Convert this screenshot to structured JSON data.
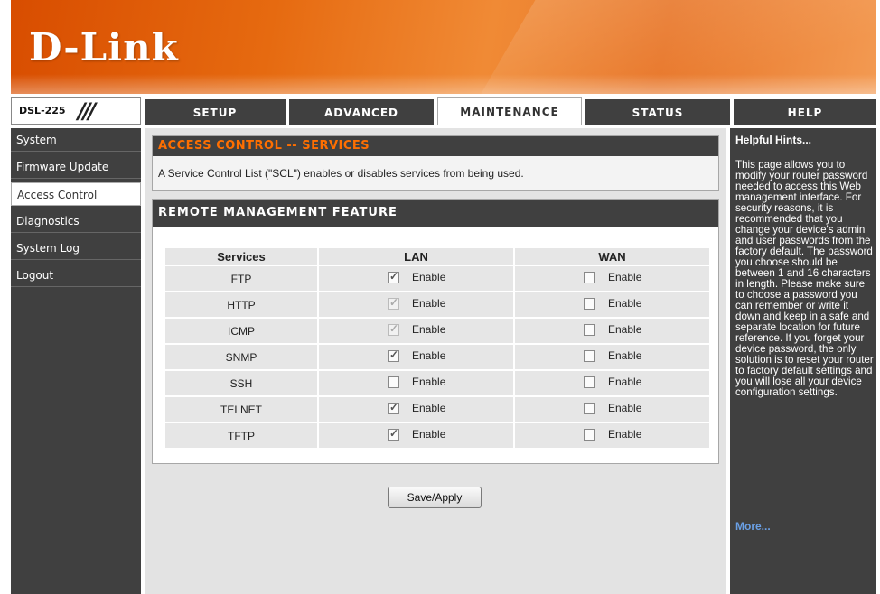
{
  "banner": {
    "logo_text": "D-Link"
  },
  "model": {
    "name": "DSL-225",
    "slash": "///"
  },
  "tabs": [
    {
      "label": "SETUP",
      "active": false
    },
    {
      "label": "ADVANCED",
      "active": false
    },
    {
      "label": "MAINTENANCE",
      "active": true
    },
    {
      "label": "STATUS",
      "active": false
    },
    {
      "label": "HELP",
      "active": false
    }
  ],
  "sidebar": {
    "items": [
      {
        "label": "System",
        "active": false
      },
      {
        "label": "Firmware Update",
        "active": false
      },
      {
        "label": "Access Control",
        "active": true
      },
      {
        "label": "Diagnostics",
        "active": false
      },
      {
        "label": "System Log",
        "active": false
      },
      {
        "label": "Logout",
        "active": false
      }
    ]
  },
  "access_control": {
    "title_part1": "ACCESS CONTROL",
    "title_sep": " -- ",
    "title_part2": "SERVICES",
    "description": "A Service Control List (\"SCL\") enables or disables services from being used."
  },
  "remote_mgmt": {
    "title": "REMOTE MANAGEMENT FEATURE",
    "headers": {
      "services": "Services",
      "lan": "LAN",
      "wan": "WAN"
    },
    "enable_label": "Enable",
    "rows": [
      {
        "service": "FTP",
        "lan_checked": true,
        "lan_disabled": false,
        "wan_checked": false
      },
      {
        "service": "HTTP",
        "lan_checked": true,
        "lan_disabled": true,
        "wan_checked": false
      },
      {
        "service": "ICMP",
        "lan_checked": true,
        "lan_disabled": true,
        "wan_checked": false
      },
      {
        "service": "SNMP",
        "lan_checked": true,
        "lan_disabled": false,
        "wan_checked": false
      },
      {
        "service": "SSH",
        "lan_checked": false,
        "lan_disabled": false,
        "wan_checked": false
      },
      {
        "service": "TELNET",
        "lan_checked": true,
        "lan_disabled": false,
        "wan_checked": false
      },
      {
        "service": "TFTP",
        "lan_checked": true,
        "lan_disabled": false,
        "wan_checked": false
      }
    ]
  },
  "save_button": {
    "label": "Save/Apply"
  },
  "help": {
    "title": "Helpful Hints...",
    "text": "This page allows you to modify your router password needed to access this Web management interface. For security reasons, it is recommended that you change your device's admin and user passwords from the factory default. The password you choose should be between 1 and 16 characters in length. Please make sure to choose a password you can remember or write it down and keep in a safe and separate location for future reference. If you forget your device password, the only solution is to reset your router to factory default settings and you will lose all your device configuration settings.",
    "more_link": "More..."
  },
  "colors": {
    "accent_orange": "#ff6f00",
    "nav_dark": "#404040",
    "content_bg": "#e3e3e3",
    "help_link": "#6aa0e6"
  }
}
